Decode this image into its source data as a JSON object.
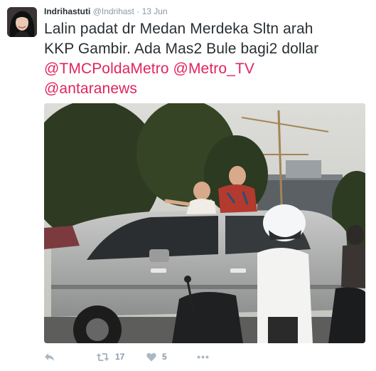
{
  "tweet": {
    "author_name": "Indrihastuti",
    "author_handle": "@Indrihast",
    "separator": "·",
    "date": "13 Jun",
    "text_line1": "Lalin padat dr Medan Merdeka Sltn arah",
    "text_line2": "KKP Gambir. Ada Mas2 Bule bagi2 dollar",
    "mention1": "@TMCPoldaMetro",
    "mention2": "@Metro_TV",
    "mention3": "@antaranews"
  },
  "actions": {
    "retweet_count": "17",
    "like_count": "5"
  },
  "icons": {
    "reply": "reply-icon",
    "retweet": "retweet-icon",
    "like": "heart-icon",
    "more": "more-icon"
  },
  "colors": {
    "mention": "#e0245e",
    "meta": "#8899a6",
    "text": "#292f33"
  }
}
